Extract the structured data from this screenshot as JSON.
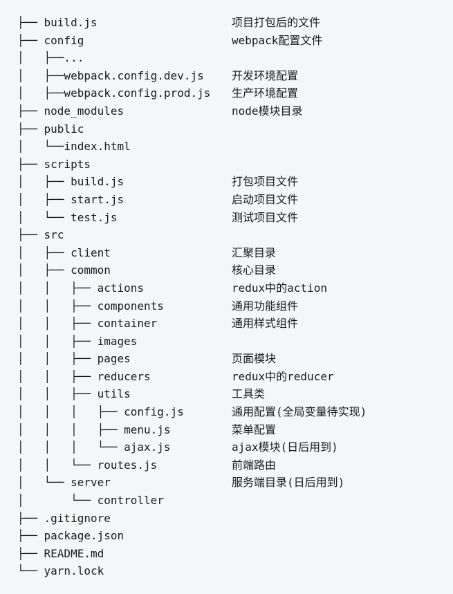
{
  "rows": [
    {
      "prefix": "├── ",
      "name": "build.js",
      "desc": "项目打包后的文件"
    },
    {
      "prefix": "├── ",
      "name": "config",
      "desc": "webpack配置文件"
    },
    {
      "prefix": "│   ├──",
      "name": "...",
      "desc": ""
    },
    {
      "prefix": "│   ├──",
      "name": "webpack.config.dev.js",
      "desc": "开发环境配置"
    },
    {
      "prefix": "│   ├──",
      "name": "webpack.config.prod.js",
      "desc": "生产环境配置"
    },
    {
      "prefix": "├── ",
      "name": "node_modules",
      "desc": "node模块目录"
    },
    {
      "prefix": "├── ",
      "name": "public",
      "desc": ""
    },
    {
      "prefix": "│   └──",
      "name": "index.html",
      "desc": ""
    },
    {
      "prefix": "├── ",
      "name": "scripts",
      "desc": ""
    },
    {
      "prefix": "│   ├── ",
      "name": "build.js",
      "desc": "打包项目文件"
    },
    {
      "prefix": "│   ├── ",
      "name": "start.js",
      "desc": "启动项目文件"
    },
    {
      "prefix": "│   └── ",
      "name": "test.js",
      "desc": "测试项目文件"
    },
    {
      "prefix": "├── ",
      "name": "src",
      "desc": ""
    },
    {
      "prefix": "│   ├── ",
      "name": "client",
      "desc": "汇聚目录"
    },
    {
      "prefix": "│   ├── ",
      "name": "common",
      "desc": "核心目录"
    },
    {
      "prefix": "│   │   ├── ",
      "name": "actions",
      "desc": "redux中的action"
    },
    {
      "prefix": "│   │   ├── ",
      "name": "components",
      "desc": "通用功能组件"
    },
    {
      "prefix": "│   │   ├── ",
      "name": "container",
      "desc": "通用样式组件"
    },
    {
      "prefix": "│   │   ├── ",
      "name": "images",
      "desc": ""
    },
    {
      "prefix": "│   │   ├── ",
      "name": "pages",
      "desc": "页面模块"
    },
    {
      "prefix": "│   │   ├── ",
      "name": "reducers",
      "desc": "redux中的reducer"
    },
    {
      "prefix": "│   │   ├── ",
      "name": "utils",
      "desc": "工具类"
    },
    {
      "prefix": "│   │   │   ├── ",
      "name": "config.js",
      "desc": "通用配置(全局变量待实现)"
    },
    {
      "prefix": "│   │   │   ├── ",
      "name": "menu.js",
      "desc": "菜单配置"
    },
    {
      "prefix": "│   │   │   └── ",
      "name": "ajax.js",
      "desc": "ajax模块(日后用到)"
    },
    {
      "prefix": "│   │   └── ",
      "name": "routes.js",
      "desc": "前端路由"
    },
    {
      "prefix": "│   └── ",
      "name": "server",
      "desc": "服务端目录(日后用到)"
    },
    {
      "prefix": "│       └── ",
      "name": "controller",
      "desc": ""
    },
    {
      "prefix": "├── ",
      "name": ".gitignore",
      "desc": ""
    },
    {
      "prefix": "├── ",
      "name": "package.json",
      "desc": ""
    },
    {
      "prefix": "├── ",
      "name": "README.md",
      "desc": ""
    },
    {
      "prefix": "└── ",
      "name": "yarn.lock",
      "desc": ""
    }
  ]
}
